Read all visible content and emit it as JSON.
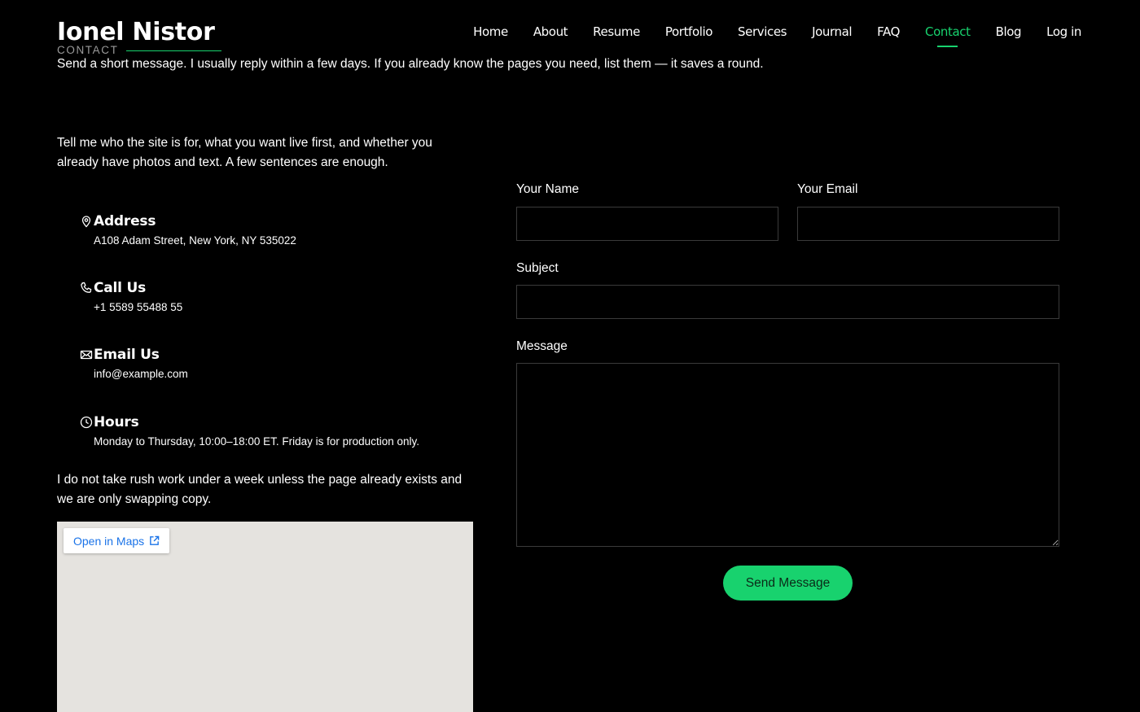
{
  "brand": {
    "name": "Ionel Nistor",
    "section": "CONTACT"
  },
  "intro": "Send a short message. I usually reply within a few days. If you already know the pages you need, list them — it saves a round.",
  "nav": {
    "items": [
      {
        "label": "Home"
      },
      {
        "label": "About"
      },
      {
        "label": "Resume"
      },
      {
        "label": "Portfolio"
      },
      {
        "label": "Services"
      },
      {
        "label": "Journal"
      },
      {
        "label": "FAQ"
      },
      {
        "label": "Contact",
        "active": true
      },
      {
        "label": "Blog"
      },
      {
        "label": "Log in"
      }
    ]
  },
  "lead": "Tell me who the site is for, what you want live first, and whether you already have photos and text. A few sentences are enough.",
  "info": {
    "address": {
      "title": "Address",
      "text": "A108 Adam Street, New York, NY 535022",
      "icon": "map-pin-icon"
    },
    "phone": {
      "title": "Call Us",
      "text": "+1 5589 55488 55",
      "icon": "phone-icon"
    },
    "email": {
      "title": "Email Us",
      "text": "info@example.com",
      "icon": "envelope-icon"
    },
    "hours": {
      "title": "Hours",
      "text": "Monday to Thursday, 10:00–18:00 ET. Friday is for production only.",
      "icon": "clock-icon"
    }
  },
  "note": "I do not take rush work under a week unless the page already exists and we are only swapping copy.",
  "map": {
    "open_label": "Open in Maps",
    "icon": "external-link-icon"
  },
  "form": {
    "name_label": "Your Name",
    "email_label": "Your Email",
    "subject_label": "Subject",
    "message_label": "Message",
    "name_value": "",
    "email_value": "",
    "subject_value": "",
    "message_value": "",
    "submit_label": "Send Message"
  },
  "colors": {
    "accent": "#18d26e",
    "background": "#000000",
    "map": "#e5e3df",
    "link": "#1a73e8"
  }
}
